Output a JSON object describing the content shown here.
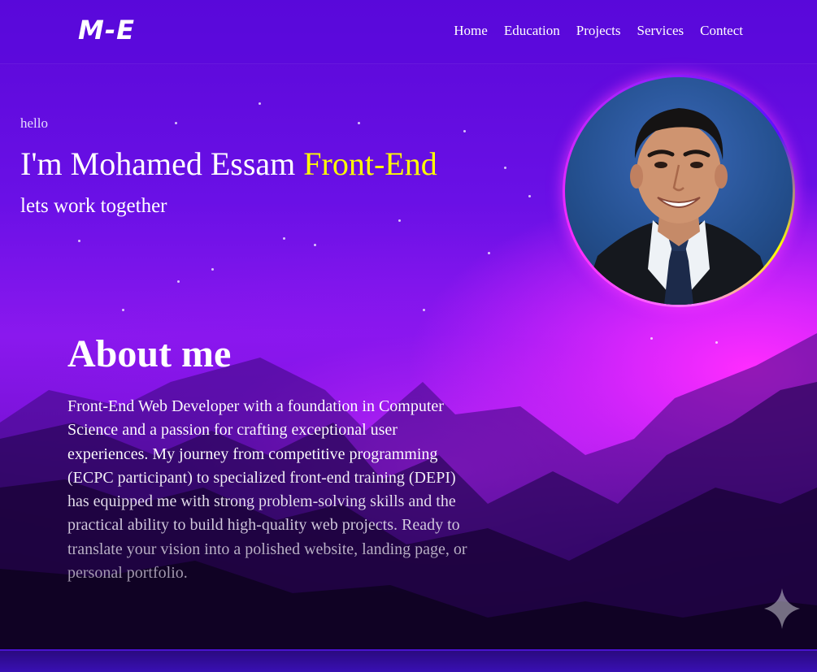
{
  "header": {
    "logo": "M-E",
    "nav": [
      "Home",
      "Education",
      "Projects",
      "Services",
      "Contect"
    ]
  },
  "hero": {
    "greeting": "hello",
    "intro": "I'm Mohamed Essam",
    "role": "Front-End",
    "tagline": "lets work together"
  },
  "about": {
    "title": "About me",
    "text": "Front-End Web Developer with a foundation in Computer Science and a passion for crafting exceptional user experiences. My journey from competitive programming (ECPC participant) to specialized front-end training (DEPI) has equipped me with strong problem-solving skills and the practical ability to build high-quality web projects. Ready to translate your vision into a polished website, landing page, or personal portfolio."
  },
  "colors": {
    "accent_yellow": "#ffff00",
    "magenta_glow": "#ff2cff",
    "violet": "#6a10e6"
  },
  "icons": {
    "sparkle": "four-point-star"
  }
}
